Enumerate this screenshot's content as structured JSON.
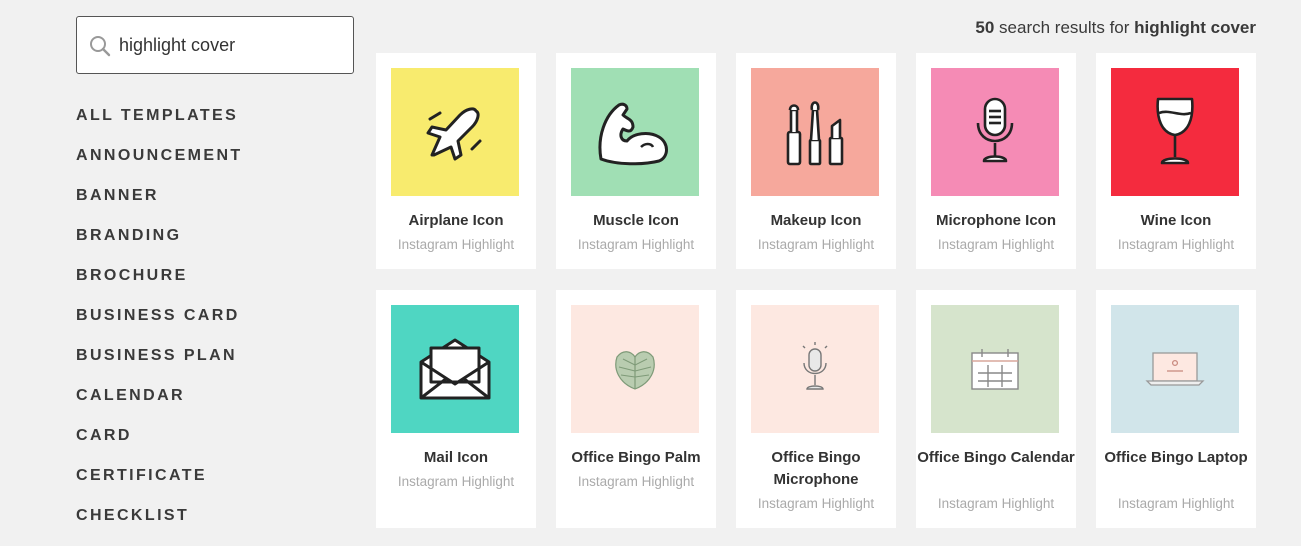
{
  "search": {
    "value": "highlight cover"
  },
  "categories": [
    "ALL TEMPLATES",
    "ANNOUNCEMENT",
    "BANNER",
    "BRANDING",
    "BROCHURE",
    "BUSINESS CARD",
    "BUSINESS PLAN",
    "CALENDAR",
    "CARD",
    "CERTIFICATE",
    "CHECKLIST"
  ],
  "results": {
    "count": "50",
    "text": "search results for",
    "query": "highlight cover"
  },
  "cards": [
    {
      "title": "Airplane Icon",
      "subtitle": "Instagram Highlight",
      "bg": "#f8eb6e",
      "icon": "airplane-icon"
    },
    {
      "title": "Muscle Icon",
      "subtitle": "Instagram Highlight",
      "bg": "#a0dfb4",
      "icon": "muscle-icon"
    },
    {
      "title": "Makeup Icon",
      "subtitle": "Instagram Highlight",
      "bg": "#f6a89c",
      "icon": "makeup-icon"
    },
    {
      "title": "Microphone Icon",
      "subtitle": "Instagram Highlight",
      "bg": "#f58bb5",
      "icon": "microphone-icon"
    },
    {
      "title": "Wine Icon",
      "subtitle": "Instagram Highlight",
      "bg": "#f42b3e",
      "icon": "wine-glass-icon"
    },
    {
      "title": "Mail Icon",
      "subtitle": "Instagram Highlight",
      "bg": "#4fd6c2",
      "icon": "envelope-icon"
    },
    {
      "title": "Office Bingo Palm",
      "subtitle": "Instagram Highlight",
      "bg": "#fde8e1",
      "icon": "palm-leaf-icon"
    },
    {
      "title": "Office Bingo Microphone",
      "subtitle": "Instagram Highlight",
      "bg": "#fde8e1",
      "icon": "microphone-icon"
    },
    {
      "title": "Office Bingo Calendar",
      "subtitle": "Instagram Highlight",
      "bg": "#d6e4cc",
      "icon": "calendar-icon"
    },
    {
      "title": "Office Bingo Laptop",
      "subtitle": "Instagram Highlight",
      "bg": "#d1e5ea",
      "icon": "laptop-icon"
    }
  ]
}
